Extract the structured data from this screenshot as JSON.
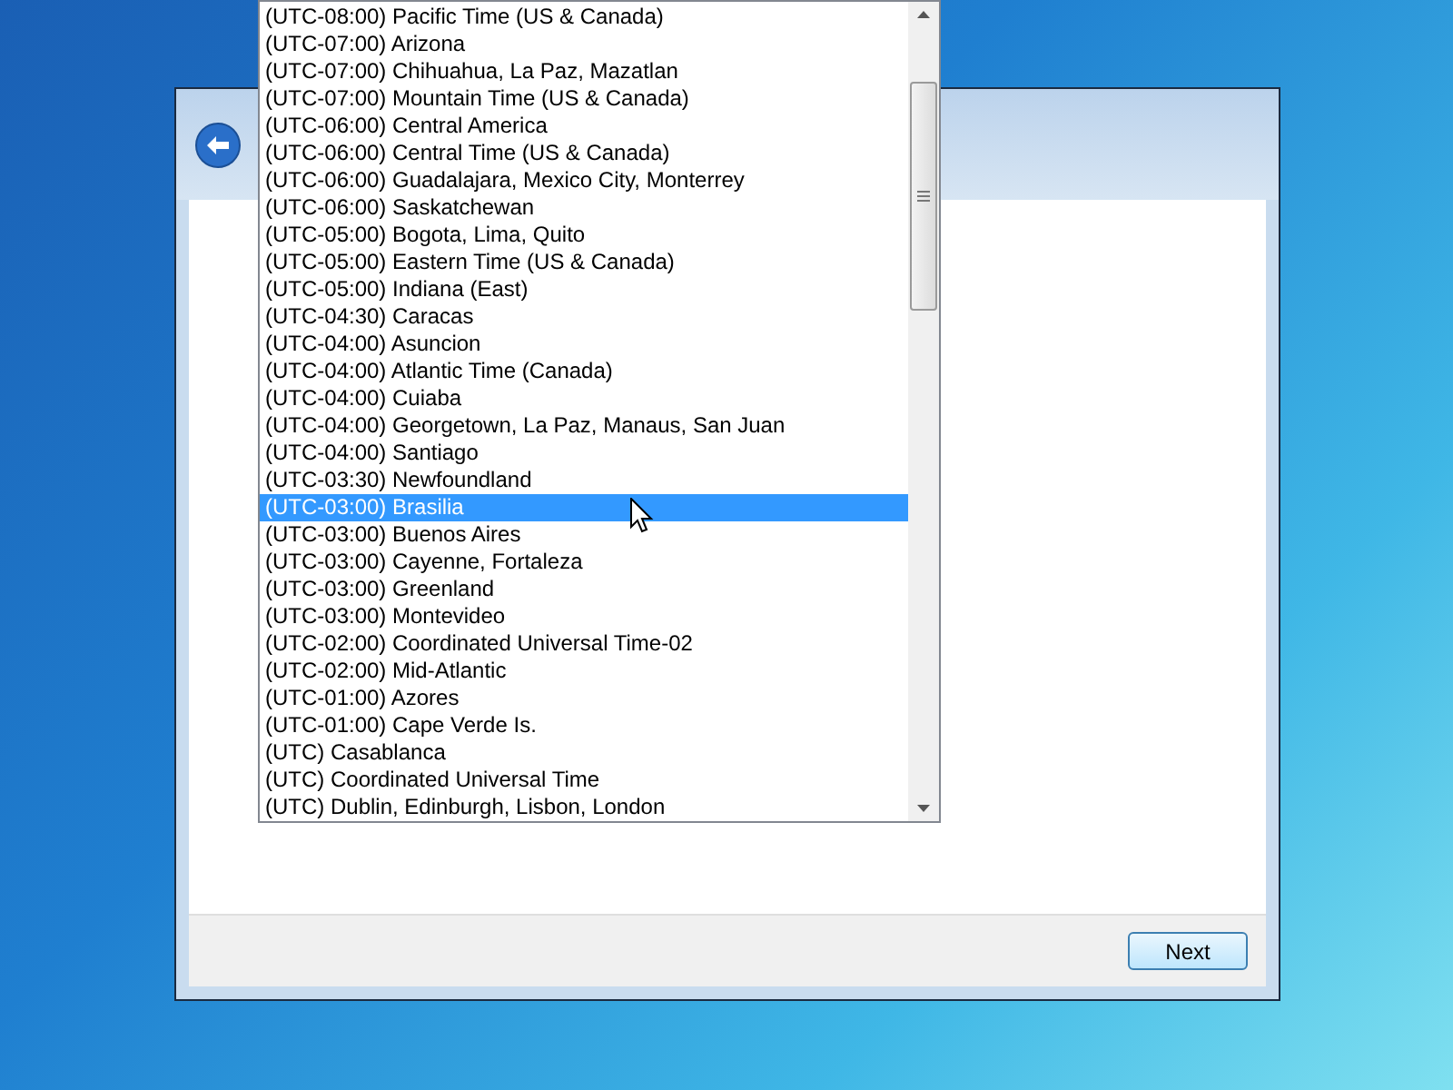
{
  "timezone_list": {
    "items": [
      {
        "label": "(UTC-08:00) Pacific Time (US & Canada)",
        "selected": false
      },
      {
        "label": "(UTC-07:00) Arizona",
        "selected": false
      },
      {
        "label": "(UTC-07:00) Chihuahua, La Paz, Mazatlan",
        "selected": false
      },
      {
        "label": "(UTC-07:00) Mountain Time (US & Canada)",
        "selected": false
      },
      {
        "label": "(UTC-06:00) Central America",
        "selected": false
      },
      {
        "label": "(UTC-06:00) Central Time (US & Canada)",
        "selected": false
      },
      {
        "label": "(UTC-06:00) Guadalajara, Mexico City, Monterrey",
        "selected": false
      },
      {
        "label": "(UTC-06:00) Saskatchewan",
        "selected": false
      },
      {
        "label": "(UTC-05:00) Bogota, Lima, Quito",
        "selected": false
      },
      {
        "label": "(UTC-05:00) Eastern Time (US & Canada)",
        "selected": false
      },
      {
        "label": "(UTC-05:00) Indiana (East)",
        "selected": false
      },
      {
        "label": "(UTC-04:30) Caracas",
        "selected": false
      },
      {
        "label": "(UTC-04:00) Asuncion",
        "selected": false
      },
      {
        "label": "(UTC-04:00) Atlantic Time (Canada)",
        "selected": false
      },
      {
        "label": "(UTC-04:00) Cuiaba",
        "selected": false
      },
      {
        "label": "(UTC-04:00) Georgetown, La Paz, Manaus, San Juan",
        "selected": false
      },
      {
        "label": "(UTC-04:00) Santiago",
        "selected": false
      },
      {
        "label": "(UTC-03:30) Newfoundland",
        "selected": false
      },
      {
        "label": "(UTC-03:00) Brasilia",
        "selected": true
      },
      {
        "label": "(UTC-03:00) Buenos Aires",
        "selected": false
      },
      {
        "label": "(UTC-03:00) Cayenne, Fortaleza",
        "selected": false
      },
      {
        "label": "(UTC-03:00) Greenland",
        "selected": false
      },
      {
        "label": "(UTC-03:00) Montevideo",
        "selected": false
      },
      {
        "label": "(UTC-02:00) Coordinated Universal Time-02",
        "selected": false
      },
      {
        "label": "(UTC-02:00) Mid-Atlantic",
        "selected": false
      },
      {
        "label": "(UTC-01:00) Azores",
        "selected": false
      },
      {
        "label": "(UTC-01:00) Cape Verde Is.",
        "selected": false
      },
      {
        "label": "(UTC) Casablanca",
        "selected": false
      },
      {
        "label": "(UTC) Coordinated Universal Time",
        "selected": false
      },
      {
        "label": "(UTC) Dublin, Edinburgh, Lisbon, London",
        "selected": false
      }
    ]
  },
  "buttons": {
    "next": "Next"
  }
}
